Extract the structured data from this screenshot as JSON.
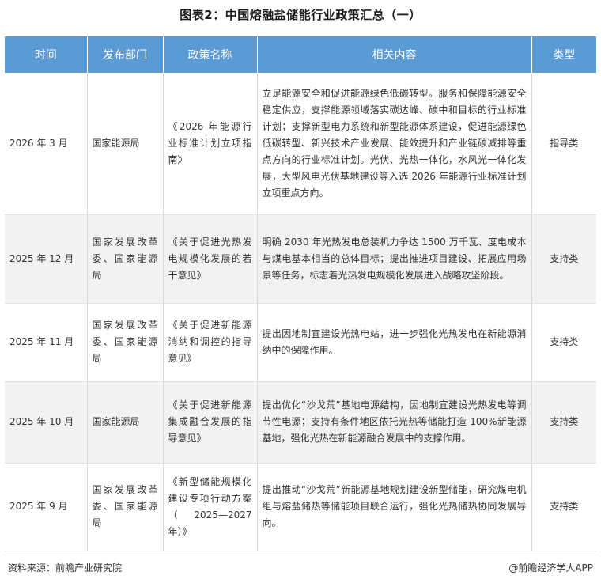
{
  "title": "图表2：中国熔融盐储能行业政策汇总（一）",
  "table": {
    "headers": [
      "时间",
      "发布部门",
      "政策名称",
      "相关内容",
      "类型"
    ],
    "rows": [
      {
        "time": "2026 年 3 月",
        "dept": "国家能源局",
        "name": "《2026 年能源行业标准计划立项指南》",
        "content": "立足能源安全和促进能源绿色低碳转型。服务和保障能源安全稳定供应，支撑能源领域落实碳达峰、碳中和目标的行业标准计划；支撑新型电力系统和新型能源体系建设，促进能源绿色低碳转型、新兴技术产业发展、能效提升和产业链碳减排等重点方向的行业标准计划。光伏、光热一体化，水风光一体化发展，大型风电光伏基地建设等入选 2026 年能源行业标准计划立项重点方向。",
        "type": "指导类"
      },
      {
        "time": "2025 年 12 月",
        "dept": "国家发展改革委、国家能源局",
        "name": "《关于促进光热发电规模化发展的若干意见》",
        "content": "明确 2030 年光热发电总装机力争达 1500 万千瓦、度电成本与煤电基本相当的总体目标；提出推进项目建设、拓展应用场景等任务，标志着光热发电规模化发展进入战略攻坚阶段。",
        "type": "支持类"
      },
      {
        "time": "2025 年 11 月",
        "dept": "国家发展改革委、国家能源局",
        "name": "《关于促进新能源消纳和调控的指导意见》",
        "content": "提出因地制宜建设光热电站，进一步强化光热发电在新能源消纳中的保障作用。",
        "type": "支持类"
      },
      {
        "time": "2025 年 10 月",
        "dept": "国家能源局",
        "name": "《关于促进新能源集成融合发展的指导意见》",
        "content": "提出优化“沙戈荒”基地电源结构，因地制宜建设光热发电等调节性电源；支持有条件地区依托光热等储能打造 100%新能源基地，强化光热在新能源融合发展中的支撑作用。",
        "type": "支持类"
      },
      {
        "time": "2025 年 9 月",
        "dept": "国家发展改革委、国家能源局",
        "name": "《新型储能规模化建设专项行动方案（2025—2027 年）》",
        "content": "提出推动“沙戈荒”新能源基地规划建设新型储能，研究煤电机组与熔盐储热等储能项目联合运行，强化光热储热协同发展导向。",
        "type": "支持类"
      }
    ]
  },
  "footer": {
    "source": "资料来源：前瞻产业研究院",
    "brand": "@前瞻经济学人APP"
  }
}
